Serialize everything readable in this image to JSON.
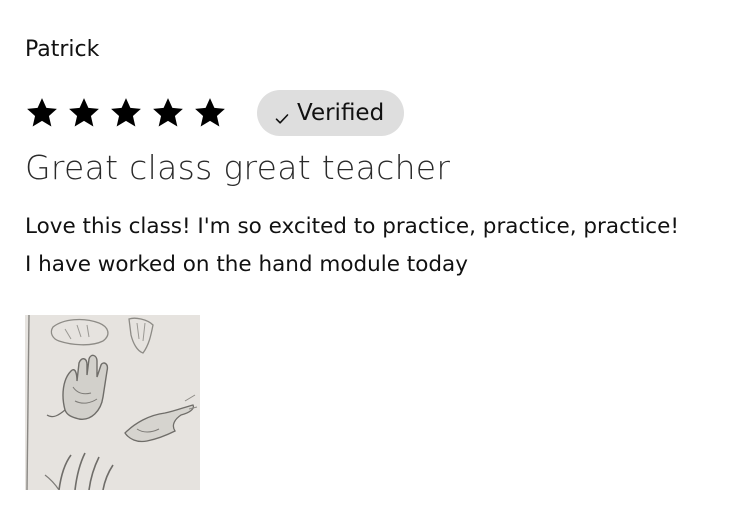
{
  "review": {
    "author": "Patrick",
    "rating": 5,
    "rating_max": 5,
    "star_color": "#000000",
    "verified_label": "Verified",
    "verified_icon": "check-icon",
    "badge_color": "#dedede",
    "title": "Great class great teacher",
    "body_lines": [
      "Love this class! I'm so excited to practice, practice, practice!",
      "I have worked on the hand module today"
    ],
    "attachment_icon": "hand-sketch-photo"
  }
}
